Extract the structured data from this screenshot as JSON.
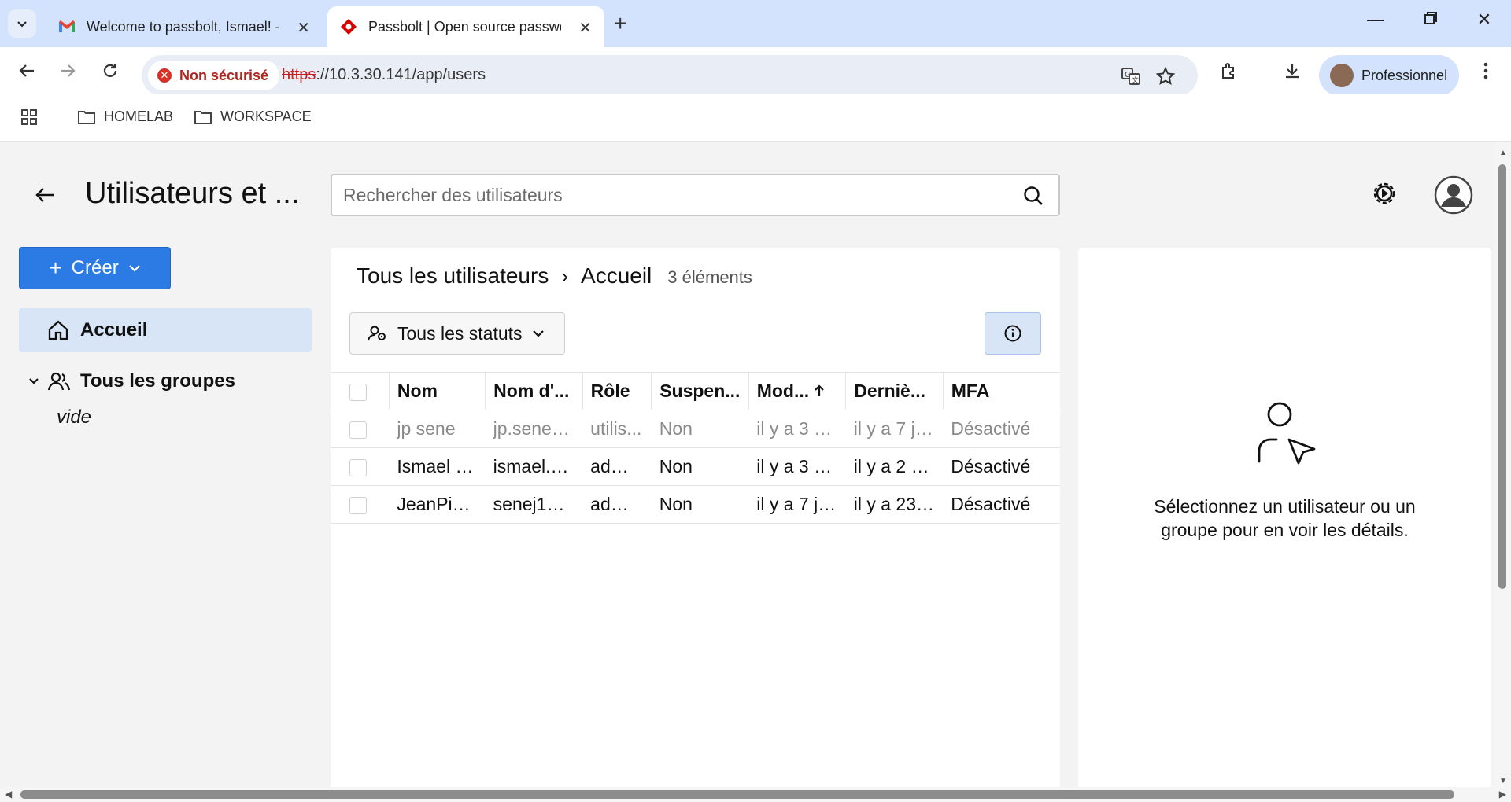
{
  "browser": {
    "tabs": [
      {
        "title": "Welcome to passbolt, Ismael! -",
        "favicon": "gmail-icon",
        "active": false
      },
      {
        "title": "Passbolt | Open source passwor",
        "favicon": "passbolt-icon",
        "active": true
      }
    ],
    "security_label": "Non sécurisé",
    "url_scheme": "https",
    "url_rest": "://10.3.30.141/app/users",
    "profile_label": "Professionnel",
    "bookmarks": [
      "HOMELAB",
      "WORKSPACE"
    ]
  },
  "app": {
    "title": "Utilisateurs et ...",
    "search_placeholder": "Rechercher des utilisateurs",
    "create_label": "Créer",
    "sidebar": {
      "home_label": "Accueil",
      "groups_label": "Tous les groupes",
      "groups_empty": "vide"
    },
    "breadcrumb": {
      "root": "Tous les utilisateurs",
      "separator": "›",
      "current": "Accueil",
      "count": "3 éléments"
    },
    "filter_label": "Tous les statuts",
    "table": {
      "columns": [
        "Nom",
        "Nom d'...",
        "Rôle",
        "Suspen...",
        "Mod...",
        "Derniè...",
        "MFA"
      ],
      "rows": [
        {
          "name": "jp sene",
          "username": "jp.sene@...",
          "role": "utilis...",
          "suspended": "Non",
          "modified": "il y a 3 m...",
          "last_login": "il y a 7 jo...",
          "mfa": "Désactivé",
          "inactive": true
        },
        {
          "name": "Ismael M...",
          "username": "ismael.m...",
          "role": "admi...",
          "suspended": "Non",
          "modified": "il y a 3 m...",
          "last_login": "il y a 2 m...",
          "mfa": "Désactivé",
          "inactive": false
        },
        {
          "name": "JeanPierr...",
          "username": "senej105...",
          "role": "admi...",
          "suspended": "Non",
          "modified": "il y a 7 jo...",
          "last_login": "il y a 23 ...",
          "mfa": "Désactivé",
          "inactive": false
        }
      ]
    },
    "details_message": "Sélectionnez un utilisateur ou un groupe pour en voir les détails."
  },
  "colors": {
    "primary": "#2c7be5",
    "tabstrip": "#d3e3fd",
    "selected_nav": "#d8e5f7",
    "insecure": "#d93025"
  }
}
